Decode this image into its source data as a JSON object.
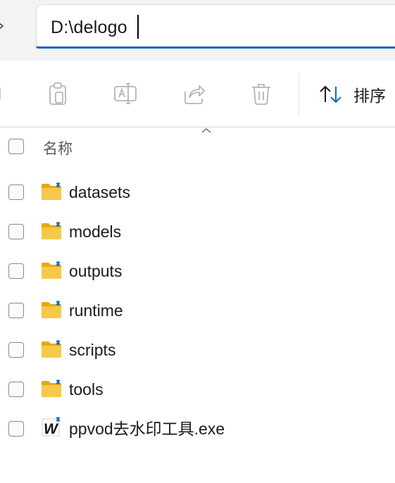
{
  "address_bar": {
    "path": "D:\\delogo"
  },
  "toolbar": {
    "sort_label": "排序",
    "buttons": [
      "copy-icon",
      "rename-icon",
      "share-icon",
      "delete-icon",
      "sort-icon"
    ]
  },
  "list_header": {
    "name_column": "名称"
  },
  "files": [
    {
      "name": "datasets",
      "type": "folder"
    },
    {
      "name": "models",
      "type": "folder"
    },
    {
      "name": "outputs",
      "type": "folder"
    },
    {
      "name": "runtime",
      "type": "folder"
    },
    {
      "name": "scripts",
      "type": "folder"
    },
    {
      "name": "tools",
      "type": "folder"
    },
    {
      "name": "ppvod去水印工具.exe",
      "type": "exe"
    }
  ],
  "colors": {
    "accent": "#1565c0",
    "folder_yellow": "#f7c948",
    "folder_tab": "#e6a817",
    "sync_badge": "#0f6cbd"
  }
}
